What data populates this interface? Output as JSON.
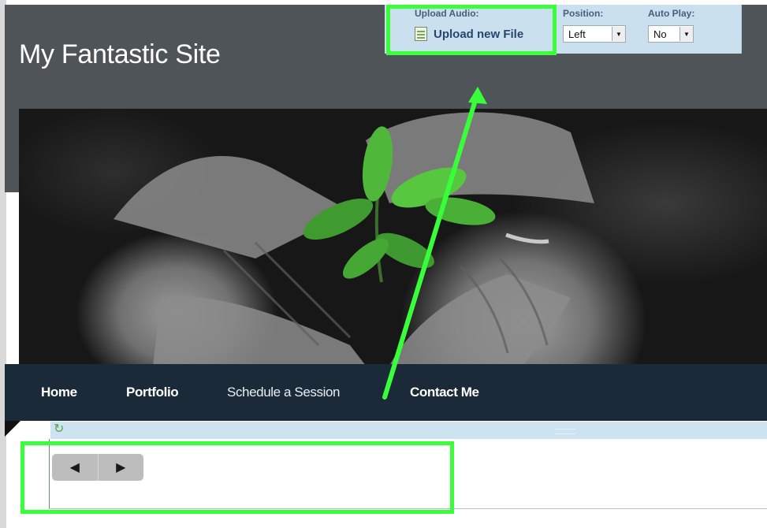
{
  "site": {
    "title": "My Fantastic Site"
  },
  "toolbar": {
    "upload_label": "Upload Audio:",
    "upload_button": "Upload new File",
    "position_label": "Position:",
    "position_value": "Left",
    "autoplay_label": "Auto Play:",
    "autoplay_value": "No"
  },
  "nav": {
    "items": [
      {
        "label": "Home"
      },
      {
        "label": "Portfolio"
      },
      {
        "label": "Schedule a Session"
      },
      {
        "label": "Contact Me"
      }
    ]
  },
  "player": {
    "prev_icon": "◀",
    "play_icon": "▶",
    "refresh_icon": "↻"
  },
  "colors": {
    "highlight": "#39ff3a",
    "header_bg": "#4f5459",
    "nav_bg": "#1a2a39",
    "toolbar_bg": "#cbe0ef"
  }
}
